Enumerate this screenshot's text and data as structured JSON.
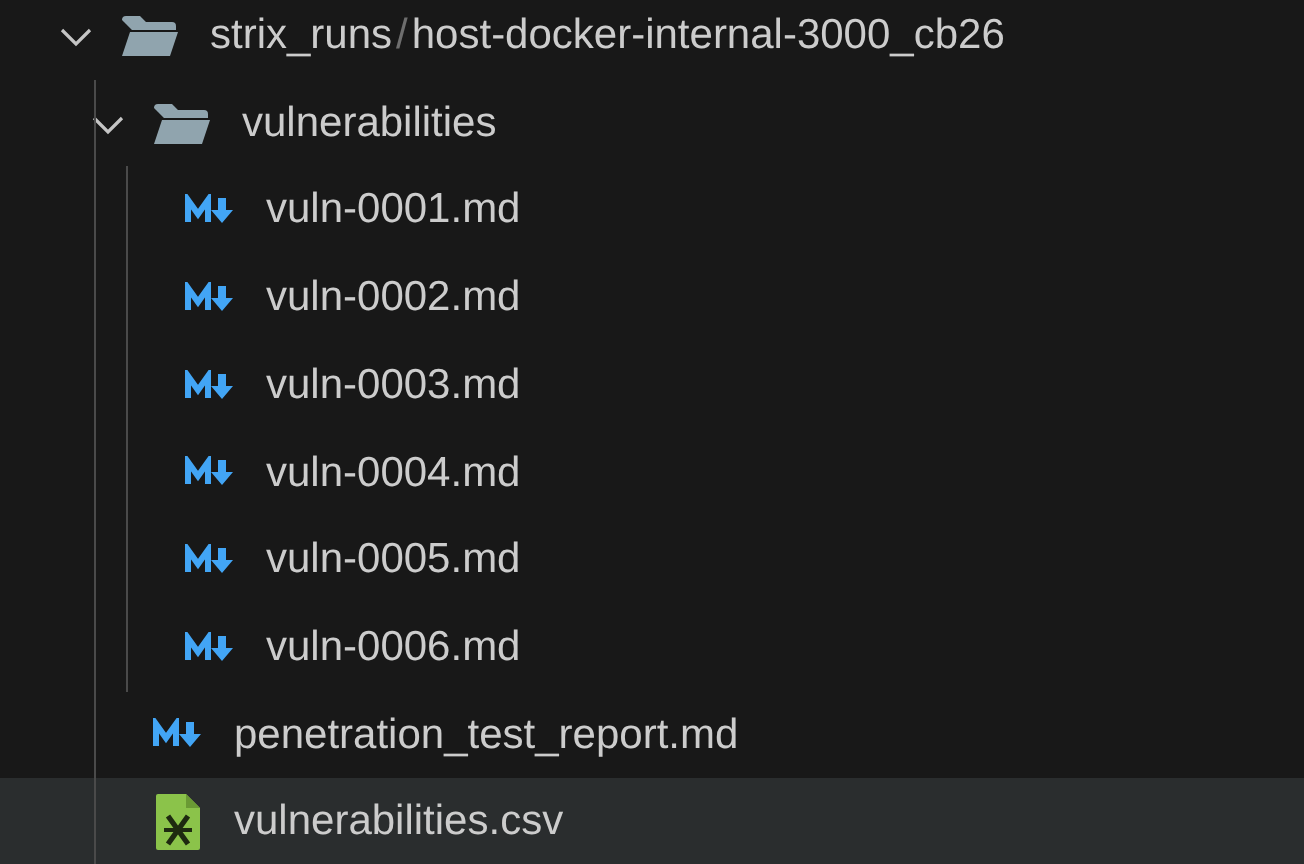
{
  "explorer": {
    "tree": [
      {
        "kind": "folder",
        "label_parts": [
          "strix_runs",
          "host-docker-internal-3000_cb26"
        ],
        "separator": "/",
        "expanded": true,
        "selected": false,
        "children": [
          {
            "kind": "folder",
            "label": "vulnerabilities",
            "expanded": true,
            "selected": false,
            "children": [
              {
                "kind": "markdown",
                "label": "vuln-0001.md",
                "selected": false
              },
              {
                "kind": "markdown",
                "label": "vuln-0002.md",
                "selected": false
              },
              {
                "kind": "markdown",
                "label": "vuln-0003.md",
                "selected": false
              },
              {
                "kind": "markdown",
                "label": "vuln-0004.md",
                "selected": false
              },
              {
                "kind": "markdown",
                "label": "vuln-0005.md",
                "selected": false
              },
              {
                "kind": "markdown",
                "label": "vuln-0006.md",
                "selected": false
              }
            ]
          },
          {
            "kind": "markdown",
            "label": "penetration_test_report.md",
            "selected": false
          },
          {
            "kind": "csv",
            "label": "vulnerabilities.csv",
            "selected": true
          }
        ]
      }
    ]
  }
}
